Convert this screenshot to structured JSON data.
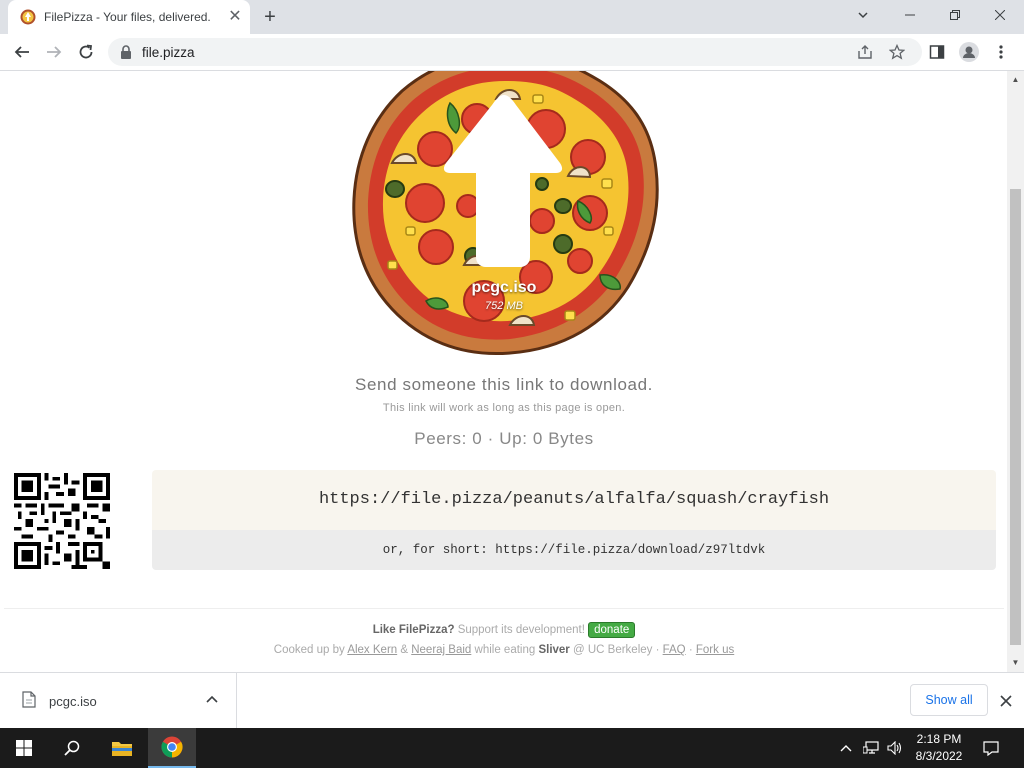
{
  "browser": {
    "tab": {
      "title": "FilePizza - Your files, delivered.",
      "close": "✕"
    },
    "new_tab": "+",
    "window_controls": {
      "minimize": "—",
      "restore": "❐",
      "close": "✕",
      "tab_search": "⌄"
    },
    "url": "file.pizza"
  },
  "page": {
    "file": {
      "name": "pcgc.iso",
      "size": "752 MB"
    },
    "send_text": "Send someone this link to download.",
    "send_subtext": "This link will work as long as this page is open.",
    "peers_text": "Peers: 0 · Up: 0 Bytes",
    "long_link": "https://file.pizza/peanuts/alfalfa/squash/crayfish",
    "short_prefix": "or, for short: ",
    "short_link": "https://file.pizza/download/z97ltdvk",
    "footer": {
      "like": "Like FilePizza?",
      "support": " Support its development! ",
      "donate": "donate",
      "cooked": "Cooked up by ",
      "author1": "Alex Kern",
      "amp": " & ",
      "author2": "Neeraj Baid",
      "eating": " while eating ",
      "sliver": "Sliver",
      "at": " @ UC Berkeley · ",
      "faq": "FAQ",
      "dot": " · ",
      "fork": "Fork us"
    }
  },
  "download_shelf": {
    "item_name": "pcgc.iso",
    "show_all": "Show all"
  },
  "taskbar": {
    "time": "2:18 PM",
    "date": "8/3/2022"
  },
  "colors": {
    "donate_green": "#44aa44",
    "link_bg": "#f8f5ee",
    "short_bg": "#ececec",
    "taskbar": "#1b1b1b",
    "chrome_frame": "#dee1e6"
  }
}
